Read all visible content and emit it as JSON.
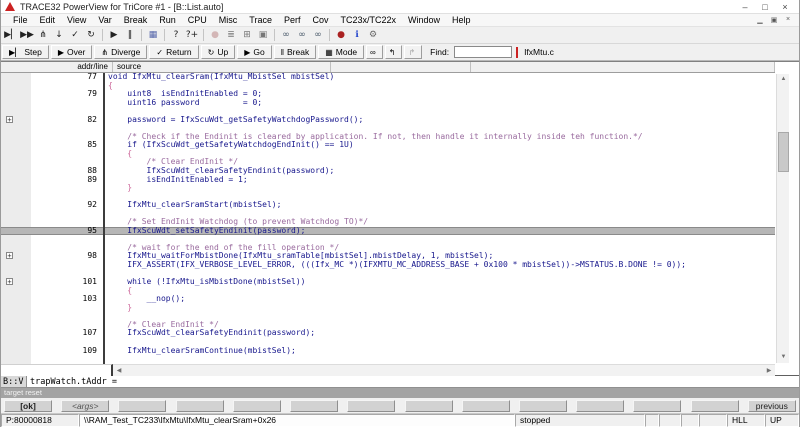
{
  "window": {
    "title": "TRACE32 PowerView for TriCore #1 - [B::List.auto]",
    "controls": [
      {
        "name": "minimize-icon",
        "glyph": "–"
      },
      {
        "name": "maximize-icon",
        "glyph": "□"
      },
      {
        "name": "close-icon",
        "glyph": "×"
      }
    ],
    "mdi_controls": [
      {
        "name": "mdi-minimize-icon",
        "glyph": "▁"
      },
      {
        "name": "mdi-restore-icon",
        "glyph": "▣"
      },
      {
        "name": "mdi-close-icon",
        "glyph": "×"
      }
    ]
  },
  "menu": {
    "items": [
      {
        "name": "menu-file",
        "label": "File"
      },
      {
        "name": "menu-edit",
        "label": "Edit"
      },
      {
        "name": "menu-view",
        "label": "View"
      },
      {
        "name": "menu-var",
        "label": "Var"
      },
      {
        "name": "menu-break",
        "label": "Break"
      },
      {
        "name": "menu-run",
        "label": "Run"
      },
      {
        "name": "menu-cpu",
        "label": "CPU"
      },
      {
        "name": "menu-misc",
        "label": "Misc"
      },
      {
        "name": "menu-trace",
        "label": "Trace"
      },
      {
        "name": "menu-perf",
        "label": "Perf"
      },
      {
        "name": "menu-cov",
        "label": "Cov"
      },
      {
        "name": "menu-tc23x-tc22x",
        "label": "TC23x/TC22x"
      },
      {
        "name": "menu-window",
        "label": "Window"
      },
      {
        "name": "menu-help",
        "label": "Help"
      }
    ]
  },
  "toolbar_main": {
    "buttons": [
      {
        "name": "single-step-icon",
        "glyph": "▶▏"
      },
      {
        "name": "step-over-icon",
        "glyph": "▶▶"
      },
      {
        "name": "diverge-icon",
        "glyph": "⋔"
      },
      {
        "name": "step-down-icon",
        "glyph": "↓"
      },
      {
        "name": "return-icon",
        "glyph": "✓"
      },
      {
        "name": "step-up-icon",
        "glyph": "↻"
      },
      {
        "sep": true
      },
      {
        "name": "go-icon",
        "glyph": "▶"
      },
      {
        "name": "break-icon",
        "glyph": "‖"
      },
      {
        "sep": true
      },
      {
        "name": "mode-icon",
        "glyph": "▦",
        "color": "#5566aa"
      },
      {
        "sep": true
      },
      {
        "name": "help-icon",
        "glyph": "?"
      },
      {
        "name": "context-help-icon",
        "glyph": "?+"
      },
      {
        "sep": true
      },
      {
        "name": "record-icon",
        "glyph": "●",
        "color": "#b07070",
        "disabled": true
      },
      {
        "name": "register-window-icon",
        "glyph": "≣",
        "color": "#777777"
      },
      {
        "name": "memory-dump-icon",
        "glyph": "⊞",
        "color": "#777777"
      },
      {
        "name": "source-list-icon",
        "glyph": "▣",
        "color": "#777777"
      },
      {
        "sep": true
      },
      {
        "name": "watch-view-icon",
        "glyph": "∞",
        "color": "#4a5a6a"
      },
      {
        "name": "variable-view-icon",
        "glyph": "∞",
        "color": "#4a5a6a"
      },
      {
        "name": "stack-view-icon",
        "glyph": "∞",
        "color": "#4a5a6a"
      },
      {
        "sep": true
      },
      {
        "name": "breakpoint-bomb-icon",
        "glyph": "●",
        "color": "#aa2222"
      },
      {
        "name": "system-info-icon",
        "glyph": "ℹ",
        "color": "#2244cc"
      },
      {
        "name": "settings-wrench-icon",
        "glyph": "⚙",
        "color": "#666666"
      }
    ]
  },
  "toolbar_nav": {
    "buttons": [
      {
        "name": "step-button",
        "glyph": "▶▏",
        "label": "Step"
      },
      {
        "name": "over-button",
        "glyph": "▶",
        "label": "Over"
      },
      {
        "name": "diverge-button",
        "glyph": "⋔",
        "label": "Diverge"
      },
      {
        "name": "return-button",
        "glyph": "✓",
        "label": "Return"
      },
      {
        "name": "up-button",
        "glyph": "↻",
        "label": "Up"
      },
      {
        "name": "go-button",
        "glyph": "▶",
        "label": "Go"
      },
      {
        "name": "break-button",
        "glyph": "‖",
        "label": "Break"
      },
      {
        "name": "mode-button",
        "glyph": "▦",
        "label": "Mode"
      },
      {
        "name": "view-glasses-button",
        "glyph": "∞",
        "label": "",
        "type": "iconbtn"
      },
      {
        "name": "goto-caller-button",
        "glyph": "↰",
        "label": "",
        "type": "iconbtn"
      },
      {
        "name": "goto-callee-button",
        "glyph": "↱",
        "label": "",
        "type": "iconbtn",
        "disabled": true
      }
    ],
    "find_label": "Find:",
    "find_value": "",
    "file_label": "IfxMtu.c"
  },
  "listwin": {
    "header": {
      "col1": "addr/line",
      "col2": "source"
    },
    "expander_glyph": "+",
    "lines": [
      {
        "num": "77",
        "text": "void IfxMtu_clearSram(IfxMtu_MbistSel mbistSel)",
        "type": "code"
      },
      {
        "num": "",
        "text": "{",
        "type": "brace"
      },
      {
        "num": "79",
        "text": "    uint8  isEndInitEnabled = 0;",
        "type": "code"
      },
      {
        "num": "",
        "text": "    uint16 password         = 0;",
        "type": "code"
      },
      {
        "num": "",
        "text": "",
        "type": "blank"
      },
      {
        "num": "82",
        "text": "    password = IfxScuWdt_getSafetyWatchdogPassword();",
        "type": "code",
        "exp": true
      },
      {
        "num": "",
        "text": "",
        "type": "blank"
      },
      {
        "num": "",
        "text": "    /* Check if the Endinit is cleared by application. If not, then handle it internally inside teh function.*/",
        "type": "comment"
      },
      {
        "num": "85",
        "text": "    if (IfxScuWdt_getSafetyWatchdogEndInit() == 1U)",
        "type": "code"
      },
      {
        "num": "",
        "text": "    {",
        "type": "brace"
      },
      {
        "num": "",
        "text": "        /* Clear EndInit */",
        "type": "comment"
      },
      {
        "num": "88",
        "text": "        IfxScuWdt_clearSafetyEndinit(password);",
        "type": "code"
      },
      {
        "num": "89",
        "text": "        isEndInitEnabled = 1;",
        "type": "code"
      },
      {
        "num": "",
        "text": "    }",
        "type": "brace"
      },
      {
        "num": "",
        "text": "",
        "type": "blank"
      },
      {
        "num": "92",
        "text": "    IfxMtu_clearSramStart(mbistSel);",
        "type": "code"
      },
      {
        "num": "",
        "text": "",
        "type": "blank"
      },
      {
        "num": "",
        "text": "    /* Set EndInit Watchdog (to prevent Watchdog TO)*/",
        "type": "comment"
      },
      {
        "num": "95",
        "text": "    IfxScuWdt_setSafetyEndinit(password);",
        "type": "code",
        "hl": true
      },
      {
        "num": "",
        "text": "",
        "type": "blank"
      },
      {
        "num": "",
        "text": "    /* wait for the end of the fill operation */",
        "type": "comment"
      },
      {
        "num": "98",
        "text": "    IfxMtu_waitForMbistDone(IfxMtu_sramTable[mbistSel].mbistDelay, 1, mbistSel);",
        "type": "code",
        "exp": true
      },
      {
        "num": "",
        "text": "    IFX_ASSERT(IFX_VERBOSE_LEVEL_ERROR, (((Ifx_MC *)(IFXMTU_MC_ADDRESS_BASE + 0x100 * mbistSel))->MSTATUS.B.DONE != 0));",
        "type": "code"
      },
      {
        "num": "",
        "text": "",
        "type": "blank"
      },
      {
        "num": "101",
        "text": "    while (!IfxMtu_isMbistDone(mbistSel))",
        "type": "code",
        "exp": true
      },
      {
        "num": "",
        "text": "    {",
        "type": "brace"
      },
      {
        "num": "103",
        "text": "        __nop();",
        "type": "code"
      },
      {
        "num": "",
        "text": "    }",
        "type": "brace"
      },
      {
        "num": "",
        "text": "",
        "type": "blank"
      },
      {
        "num": "",
        "text": "    /* Clear EndInit */",
        "type": "comment"
      },
      {
        "num": "107",
        "text": "    IfxScuWdt_clearSafetyEndinit(password);",
        "type": "code"
      },
      {
        "num": "",
        "text": "",
        "type": "blank"
      },
      {
        "num": "109",
        "text": "    IfxMtu_clearSramContinue(mbistSel);",
        "type": "code"
      },
      {
        "num": "",
        "text": "",
        "type": "blank"
      }
    ],
    "scroll_icons": {
      "up": "▲",
      "down": "▼",
      "left": "◀",
      "right": "▶"
    }
  },
  "cmdline": {
    "prompt": "B::V",
    "value": "trapWatch.tAddr ="
  },
  "message_line": "target reset",
  "softkeys": {
    "buttons": [
      {
        "name": "softkey-ok",
        "label": "[ok]",
        "type": "ok"
      },
      {
        "name": "softkey-args",
        "label": "<args>",
        "type": "args"
      },
      {
        "name": "softkey-blank",
        "label": ""
      },
      {
        "name": "softkey-blank",
        "label": ""
      },
      {
        "name": "softkey-blank",
        "label": ""
      },
      {
        "name": "softkey-blank",
        "label": ""
      },
      {
        "name": "softkey-blank",
        "label": ""
      },
      {
        "name": "softkey-blank",
        "label": ""
      },
      {
        "name": "softkey-blank",
        "label": ""
      },
      {
        "name": "softkey-blank",
        "label": ""
      },
      {
        "name": "softkey-blank",
        "label": ""
      },
      {
        "name": "softkey-blank",
        "label": ""
      },
      {
        "name": "softkey-blank",
        "label": ""
      },
      {
        "name": "softkey-previous",
        "label": "previous"
      }
    ]
  },
  "statusbar": {
    "address": "P:80000818",
    "symbol": "\\\\RAM_Test_TC233\\IfxMtu\\IfxMtu_clearSram+0x26",
    "state": "stopped",
    "mode": "HLL",
    "direction": "UP"
  }
}
